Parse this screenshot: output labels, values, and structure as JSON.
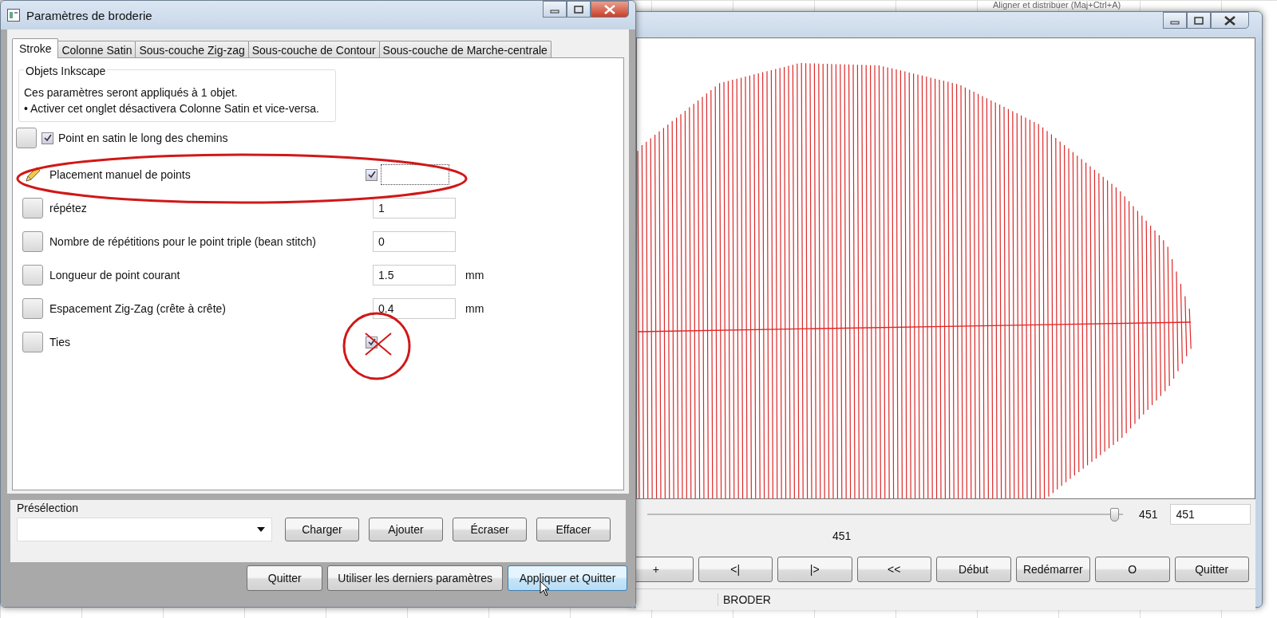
{
  "background": {
    "menu_text": "Aligner et distribuer (Maj+Ctrl+A)"
  },
  "dialog": {
    "title": "Paramètres de broderie",
    "tabs": [
      {
        "label": "Stroke",
        "selected": true
      },
      {
        "label": "Colonne Satin",
        "selected": false
      },
      {
        "label": "Sous-couche Zig-zag",
        "selected": false
      },
      {
        "label": "Sous-couche de Contour",
        "selected": false
      },
      {
        "label": "Sous-couche de Marche-centrale",
        "selected": false
      }
    ],
    "group": {
      "title": "Objets Inkscape",
      "lines": [
        "Ces paramètres seront appliqués à 1 objet.",
        "• Activer cet onglet désactivera Colonne Satin et vice-versa."
      ]
    },
    "enable": {
      "label": "Point en satin le long des chemins",
      "checked": true
    },
    "params": [
      {
        "label": "Placement manuel de points",
        "kind": "togglefield",
        "modified": true,
        "checked": true
      },
      {
        "label": "répétez",
        "kind": "number",
        "modified": false,
        "value": "1"
      },
      {
        "label": "Nombre de répétitions pour le point triple (bean stitch)",
        "kind": "number",
        "modified": false,
        "value": "0"
      },
      {
        "label": "Longueur de point courant",
        "kind": "number",
        "modified": false,
        "value": "1.5",
        "unit": "mm"
      },
      {
        "label": "Espacement Zig-Zag (crête à crête)",
        "kind": "number",
        "modified": false,
        "value": "0.4",
        "unit": "mm"
      },
      {
        "label": "Ties",
        "kind": "toggle",
        "modified": false,
        "checked": true
      }
    ],
    "preset": {
      "title": "Présélection",
      "buttons": [
        "Charger",
        "Ajouter",
        "Écraser",
        "Effacer"
      ]
    },
    "buttons": [
      {
        "label": "Quitter",
        "focused": false
      },
      {
        "label": "Utiliser les derniers paramètres",
        "focused": false
      },
      {
        "label": "Appliquer et Quitter",
        "focused": true
      }
    ]
  },
  "simulator": {
    "slider": {
      "level": 0.99,
      "reading": "451"
    },
    "frame_field": "451",
    "frame_label": "451",
    "buttons": [
      "+",
      "<|",
      "|>",
      "<<",
      "Début",
      "Redémarrer",
      "O",
      "Quitter"
    ],
    "status": "BRODER"
  }
}
